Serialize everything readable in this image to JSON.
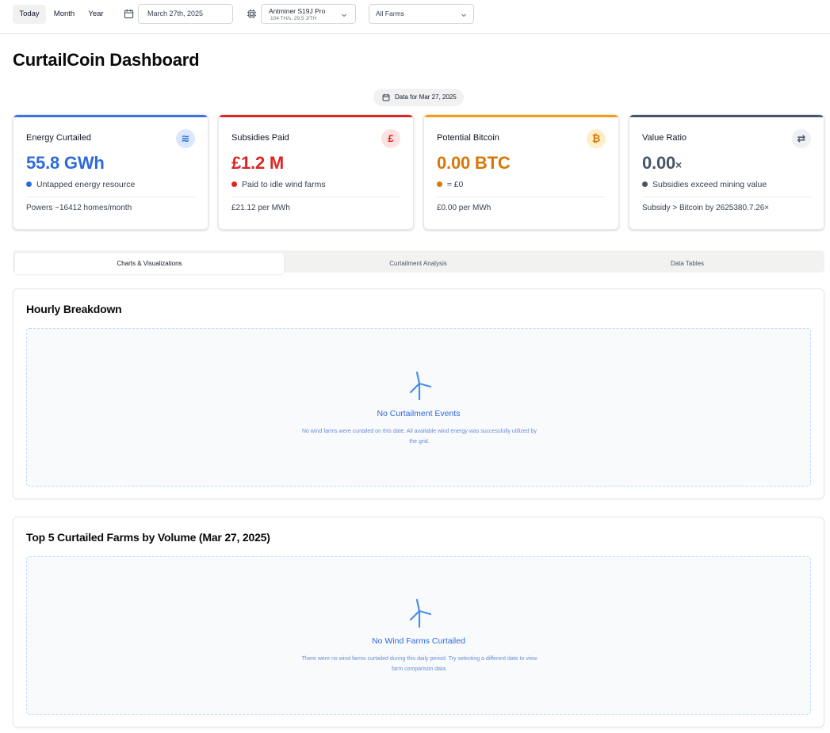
{
  "topbar": {
    "periods": [
      "Today",
      "Month",
      "Year"
    ],
    "date_value": "March 27th, 2025",
    "miner": {
      "name": "Antminer S19J Pro",
      "spec": "104 TH/s, 29.5 J/TH"
    },
    "farm_filter": "All Farms"
  },
  "page": {
    "title": "CurtailCoin Dashboard",
    "data_date": "Data for Mar 27, 2025"
  },
  "cards": [
    {
      "title": "Energy Curtailed",
      "icon": "wind-lines-icon",
      "icon_glyph": "≋",
      "value": "55.8 GWh",
      "unit": "",
      "accent": "#3b74e0",
      "value_color": "#2f6ad9",
      "icon_bg": "#dbe7fb",
      "icon_color": "#2f6ad9",
      "dot": "#2f6ad9",
      "note": "Untapped energy resource",
      "foot": "Powers ~16412 homes/month"
    },
    {
      "title": "Subsidies Paid",
      "icon": "pound-icon",
      "icon_glyph": "£",
      "value": "£1.2 M",
      "unit": "",
      "accent": "#dc2626",
      "value_color": "#dc2626",
      "icon_bg": "#fde2e2",
      "icon_color": "#dc2626",
      "dot": "#dc2626",
      "note": "Paid to idle wind farms",
      "foot": "£21.12 per MWh"
    },
    {
      "title": "Potential Bitcoin",
      "icon": "bitcoin-icon",
      "icon_glyph": "₿",
      "value": "0.00 BTC",
      "unit": "",
      "accent": "#f59e0b",
      "value_color": "#d97706",
      "icon_bg": "#fdefc7",
      "icon_color": "#d97706",
      "dot": "#d97706",
      "note": "≈ £0",
      "foot": "£0.00 per MWh"
    },
    {
      "title": "Value Ratio",
      "icon": "swap-arrows-icon",
      "icon_glyph": "⇄",
      "value": "0.00",
      "unit": "×",
      "accent": "#475569",
      "value_color": "#475569",
      "icon_bg": "#eef0f3",
      "icon_color": "#475569",
      "dot": "#475569",
      "note": "Subsidies exceed mining value",
      "foot": "Subsidy > Bitcoin by 2625380.7.26×"
    }
  ],
  "tabs": [
    "Charts & Visualizations",
    "Curtailment Analysis",
    "Data Tables"
  ],
  "hourly": {
    "title": "Hourly Breakdown",
    "empty_title": "No Curtailment Events",
    "empty_desc": "No wind farms were curtailed on this date. All available wind energy was successfully utilized by the grid."
  },
  "top_farms": {
    "title": "Top 5 Curtailed Farms by Volume (Mar 27, 2025)",
    "empty_title": "No Wind Farms Curtailed",
    "empty_desc": "There were no wind farms curtailed during this daily period. Try selecting a different date to view farm comparison data."
  }
}
